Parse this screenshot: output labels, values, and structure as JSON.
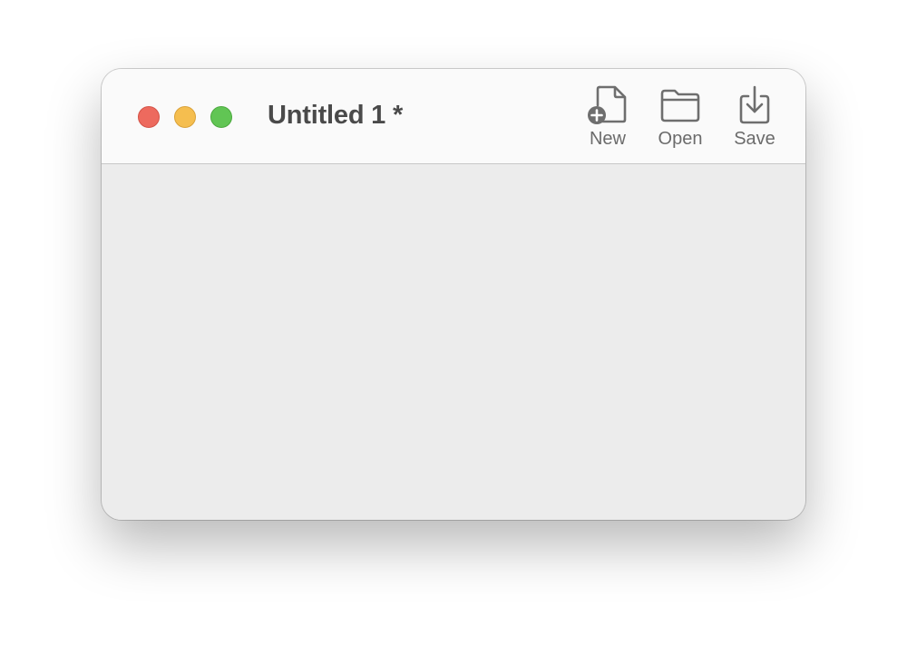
{
  "window": {
    "title": "Untitled 1 *",
    "traffic_lights": {
      "close_color": "#ed6a5e",
      "minimize_color": "#f5be4f",
      "zoom_color": "#61c554"
    }
  },
  "toolbar": {
    "items": [
      {
        "label": "New",
        "icon": "new-document-icon"
      },
      {
        "label": "Open",
        "icon": "folder-icon"
      },
      {
        "label": "Save",
        "icon": "save-download-icon"
      }
    ]
  }
}
